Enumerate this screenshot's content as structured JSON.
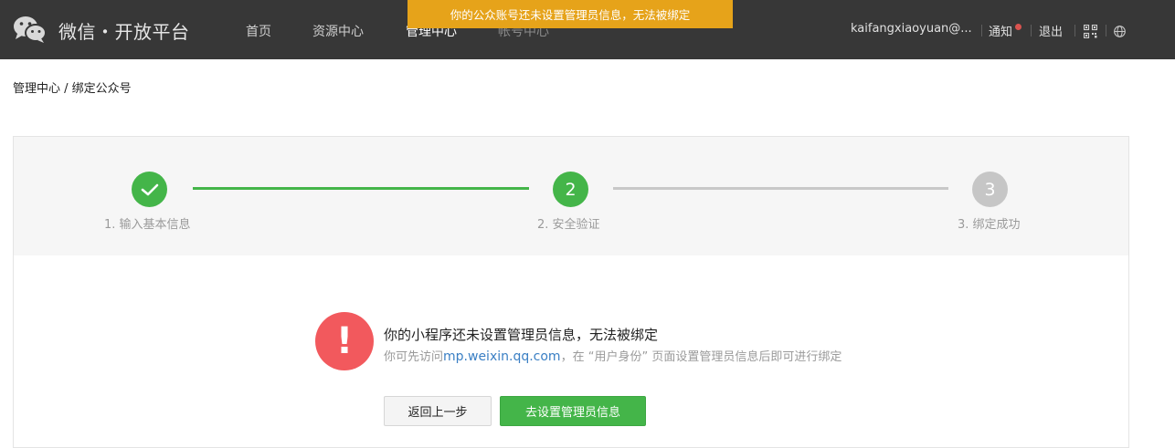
{
  "header": {
    "logo_text": "微信・开放平台",
    "nav": [
      "首页",
      "资源中心",
      "管理中心",
      "帐号中心"
    ],
    "account": "kaifangxiaoyuan@...",
    "notify_label": "通知",
    "logout_label": "退出"
  },
  "notice": "你的公众账号还未设置管理员信息，无法被绑定",
  "breadcrumb": "管理中心 / 绑定公众号",
  "steps": [
    {
      "number": "1",
      "label": "1. 输入基本信息",
      "status": "done"
    },
    {
      "number": "2",
      "label": "2. 安全验证",
      "status": "current"
    },
    {
      "number": "3",
      "label": "3. 绑定成功",
      "status": "pending"
    }
  ],
  "message": {
    "icon_text": "!",
    "title": "你的小程序还未设置管理员信息，无法被绑定",
    "desc_prefix": "你可先访问",
    "link": "mp.weixin.qq.com",
    "desc_suffix": "，在 “用户身份” 页面设置管理员信息后即可进行绑定"
  },
  "buttons": {
    "back": "返回上一步",
    "go": "去设置管理员信息"
  },
  "colors": {
    "green": "#44b549",
    "warning": "#f2595d",
    "notice": "#e6a31a",
    "topbar": "#373737"
  }
}
